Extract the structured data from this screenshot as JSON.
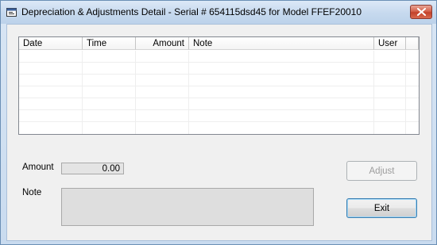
{
  "window": {
    "title": "Depreciation & Adjustments Detail - Serial # 654115dsd45 for Model FFEF20010",
    "icon": "app-window-icon",
    "close_icon": "close-icon"
  },
  "list": {
    "columns": [
      {
        "label": "Date"
      },
      {
        "label": "Time"
      },
      {
        "label": "Amount"
      },
      {
        "label": "Note"
      },
      {
        "label": "User"
      }
    ],
    "rows": []
  },
  "form": {
    "amount_label": "Amount",
    "amount_value": "0.00",
    "note_label": "Note",
    "note_value": ""
  },
  "buttons": {
    "adjust_label": "Adjust",
    "exit_label": "Exit"
  },
  "colors": {
    "close_button": "#c3412a",
    "disabled_text": "#9c9c9c"
  }
}
